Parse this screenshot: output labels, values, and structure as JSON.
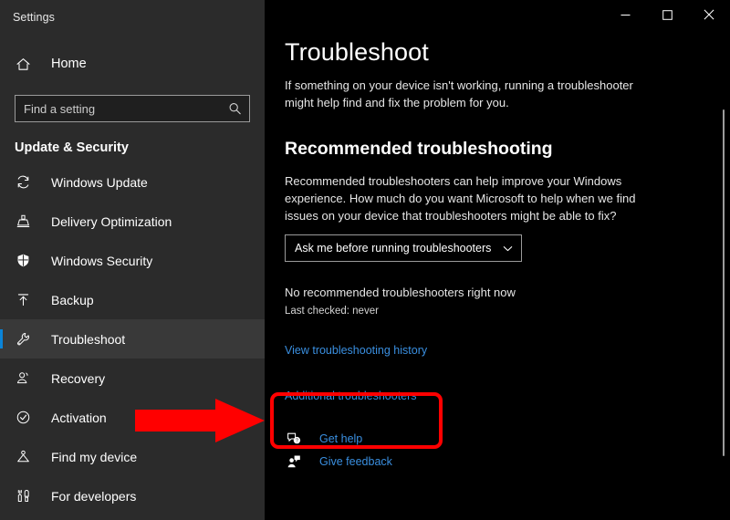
{
  "window": {
    "app_title": "Settings",
    "controls": [
      {
        "name": "minimize",
        "glyph": "—"
      },
      {
        "name": "maximize",
        "glyph": "□"
      },
      {
        "name": "close",
        "glyph": "✕"
      }
    ]
  },
  "sidebar": {
    "home_label": "Home",
    "home_icon": "home-icon",
    "search": {
      "placeholder": "Find a setting",
      "value": "",
      "icon": "search-icon"
    },
    "section_title": "Update & Security",
    "items": [
      {
        "label": "Windows Update",
        "icon": "sync-icon",
        "selected": false
      },
      {
        "label": "Delivery Optimization",
        "icon": "delivery-icon",
        "selected": false
      },
      {
        "label": "Windows Security",
        "icon": "shield-icon",
        "selected": false
      },
      {
        "label": "Backup",
        "icon": "upload-icon",
        "selected": false
      },
      {
        "label": "Troubleshoot",
        "icon": "wrench-icon",
        "selected": true
      },
      {
        "label": "Recovery",
        "icon": "recovery-icon",
        "selected": false
      },
      {
        "label": "Activation",
        "icon": "check-circle-icon",
        "selected": false
      },
      {
        "label": "Find my device",
        "icon": "locate-icon",
        "selected": false
      },
      {
        "label": "For developers",
        "icon": "tools-icon",
        "selected": false
      }
    ]
  },
  "main": {
    "page_title": "Troubleshoot",
    "page_description": "If something on your device isn't working, running a troubleshooter might help find and fix the problem for you.",
    "recommended": {
      "heading": "Recommended troubleshooting",
      "description": "Recommended troubleshooters can help improve your Windows experience. How much do you want Microsoft to help when we find issues on your device that troubleshooters might be able to fix?",
      "dropdown": {
        "selected": "Ask me before running troubleshooters",
        "chevron_icon": "chevron-down-icon"
      },
      "status": "No recommended troubleshooters right now",
      "last_checked": "Last checked: never"
    },
    "links": {
      "view_history": "View troubleshooting history",
      "additional": "Additional troubleshooters"
    },
    "help": [
      {
        "label": "Get help",
        "icon": "help-bubble-icon"
      },
      {
        "label": "Give feedback",
        "icon": "feedback-person-icon"
      }
    ]
  },
  "annotations": {
    "arrow_color": "#ff0000",
    "highlight_color": "#ff0000",
    "points_to": "Additional troubleshooters"
  },
  "colors": {
    "sidebar_bg": "#2b2b2b",
    "content_bg": "#000000",
    "accent": "#0a84d8",
    "link": "#3a8fe0",
    "annotation": "#ff0000"
  }
}
